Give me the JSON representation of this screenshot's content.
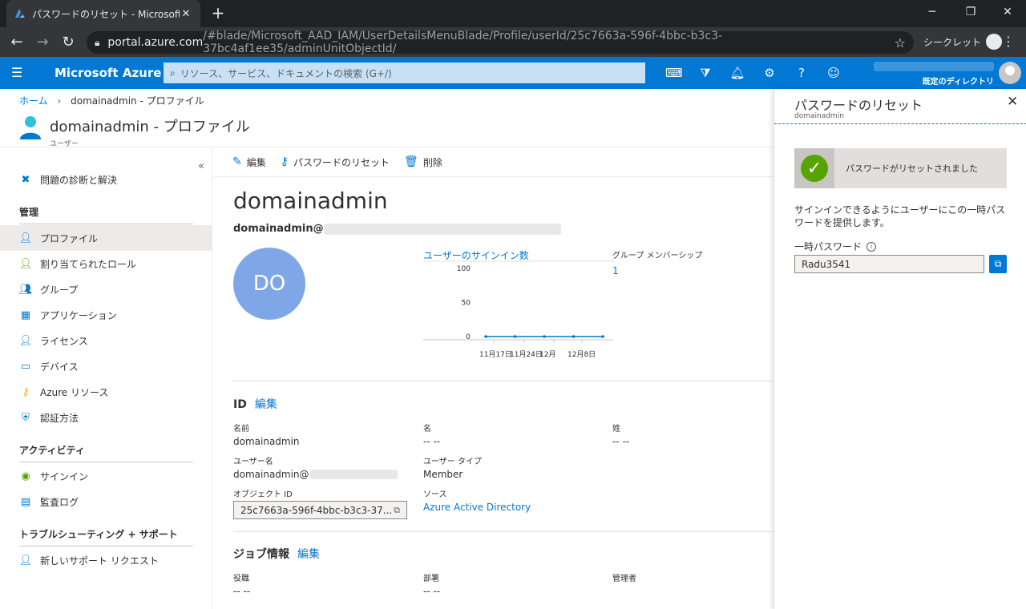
{
  "browser": {
    "tab_title": "パスワードのリセット - Microsoft Azure",
    "new_tab": "+",
    "url_host": "portal.azure.com",
    "url_path": "/#blade/Microsoft_AAD_IAM/UserDetailsMenuBlade/Profile/userId/25c7663a-596f-4bbc-b3c3-37bc4af1ee35/adminUnitObjectId/",
    "incognito_label": "シークレット"
  },
  "azure_header": {
    "brand": "Microsoft Azure",
    "search_placeholder": "リソース、サービス、ドキュメントの検索 (G+/)",
    "directory_label": "既定のディレクトリ"
  },
  "breadcrumb": {
    "home": "ホーム",
    "current": "domainadmin - プロファイル"
  },
  "page": {
    "title": "domainadmin - プロファイル",
    "subtitle": "ユーザー"
  },
  "left_nav": {
    "items_top": [
      {
        "label": "問題の診断と解決"
      }
    ],
    "section_manage": "管理",
    "manage_items": [
      {
        "label": "プロファイル"
      },
      {
        "label": "割り当てられたロール"
      },
      {
        "label": "グループ"
      },
      {
        "label": "アプリケーション"
      },
      {
        "label": "ライセンス"
      },
      {
        "label": "デバイス"
      },
      {
        "label": "Azure リソース"
      },
      {
        "label": "認証方法"
      }
    ],
    "section_activity": "アクティビティ",
    "activity_items": [
      {
        "label": "サインイン"
      },
      {
        "label": "監査ログ"
      }
    ],
    "section_support": "トラブルシューティング + サポート",
    "support_items": [
      {
        "label": "新しいサポート リクエスト"
      }
    ]
  },
  "toolbar": {
    "edit": "編集",
    "reset_password": "パスワードのリセット",
    "delete": "削除"
  },
  "profile": {
    "display_name": "domainadmin",
    "email_prefix": "domainadmin@",
    "initials": "DO",
    "group_membership_label": "グループ メンバーシップ",
    "group_membership_count": "1"
  },
  "chart_data": {
    "type": "line",
    "title": "ユーザーのサインイン数",
    "ylabel": "",
    "xlabel": "",
    "y_ticks": [
      "100",
      "50",
      "0"
    ],
    "x_ticks": [
      "11月17日",
      "11月24日",
      "12月",
      "12月8日"
    ],
    "ylim": [
      0,
      100
    ],
    "x": [
      0,
      1,
      2,
      3,
      4
    ],
    "series": [
      {
        "values": [
          0,
          0,
          0,
          0,
          0
        ]
      }
    ],
    "grid": false,
    "color": "#0078d4"
  },
  "identity_section": {
    "title": "ID",
    "edit": "編集",
    "name_label": "名前",
    "name_value": "domainadmin",
    "given_name_label": "名",
    "given_name_value": "-- --",
    "surname_label": "姓",
    "surname_value": "-- --",
    "username_label": "ユーザー名",
    "username_value": "domainadmin@",
    "user_type_label": "ユーザー タイプ",
    "user_type_value": "Member",
    "object_id_label": "オブジェクト ID",
    "object_id_value": "25c7663a-596f-4bbc-b3c3-37...",
    "source_label": "ソース",
    "source_value": "Azure Active Directory"
  },
  "job_section": {
    "title": "ジョブ情報",
    "edit": "編集",
    "job_title_label": "役職",
    "job_title_value": "-- --",
    "department_label": "部署",
    "department_value": "-- --",
    "manager_label": "管理者"
  },
  "reset_panel": {
    "title": "パスワードのリセット",
    "subtitle": "domainadmin",
    "success_message": "パスワードがリセットされました",
    "description": "サインインできるようにユーザーにこの一時パスワードを提供します。",
    "temp_password_label": "一時パスワード",
    "temp_password_value": "Radu3541"
  },
  "colors": {
    "azure_blue": "#0078d4",
    "success_green": "#57a300",
    "avatar_blue": "#7fa7e8"
  }
}
